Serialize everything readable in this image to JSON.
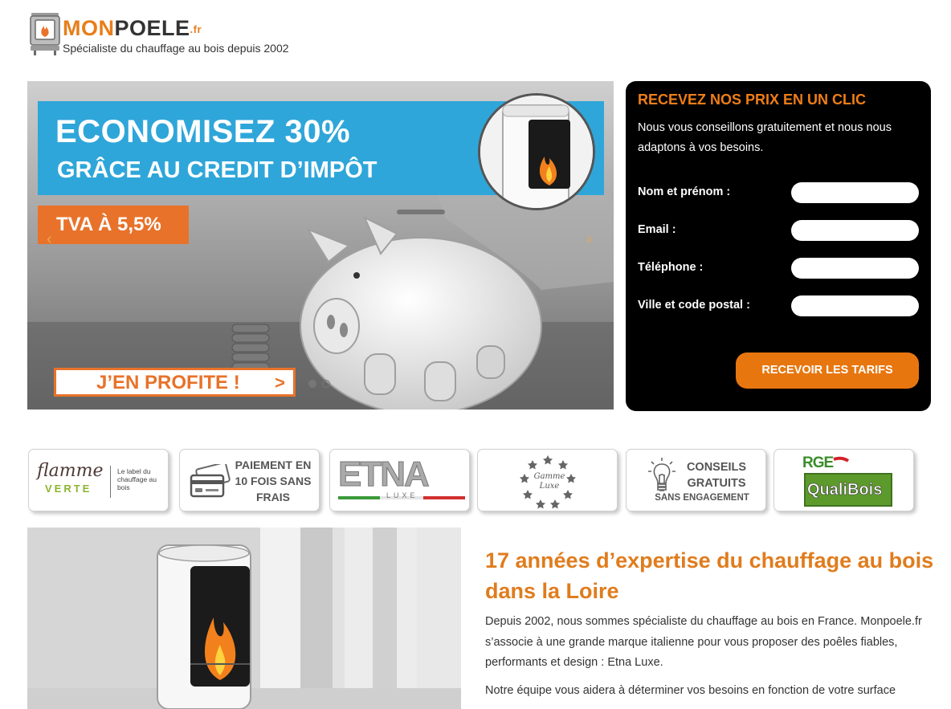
{
  "header": {
    "logo_mon": "MON",
    "logo_poele": "POELE",
    "logo_tld": ".fr",
    "tagline": "Spécialiste du chauffage au bois depuis 2002"
  },
  "hero": {
    "headline": "ECONOMISEZ 30%",
    "subheadline": "GRÂCE AU CREDIT D’IMPÔT",
    "tva": "TVA À 5,5%",
    "cta_label": "J’EN PROFITE !",
    "cta_arrow": ">",
    "prev_arrow": "‹",
    "next_arrow": "›",
    "slide_count": 2,
    "active_slide": 1
  },
  "form": {
    "title": "RECEVEZ NOS PRIX EN UN CLIC",
    "intro": "Nous vous conseillons gratuitement et nous nous adaptons à vos besoins.",
    "fields": [
      {
        "label": "Nom et prénom :",
        "value": "",
        "placeholder": ""
      },
      {
        "label": "Email :",
        "value": "",
        "placeholder": ""
      },
      {
        "label": "Téléphone :",
        "value": "",
        "placeholder": ""
      },
      {
        "label": "Ville et code postal :",
        "value": "",
        "placeholder": ""
      }
    ],
    "submit_label": "RECEVOIR LES TARIFS"
  },
  "badges": {
    "flamme_line1": "flamme",
    "flamme_line2": "VERTE",
    "flamme_desc": "Le label du chauffage au bois",
    "payment_text": "PAIEMENT EN 10 FOIS SANS FRAIS",
    "etna_text": "ETNA",
    "etna_sub": "LUXE",
    "gamme_text": "Gamme Luxe",
    "conseils_text": "CONSEILS GRATUITS",
    "conseils_sub": "SANS ENGAGEMENT",
    "rge_text": "RGE",
    "qualibois_text": "QualiBois"
  },
  "section": {
    "title": "17 années d’expertise du chauffage au bois dans la Loire",
    "paragraph1": "Depuis 2002, nous sommes spécialiste du chauffage au bois en France. Monpoele.fr s’associe à une grande marque italienne pour vous proposer des poêles fiables, performants et design : Etna Luxe.",
    "paragraph2": "Notre équipe vous aidera à déterminer vos besoins en fonction de votre surface"
  },
  "colors": {
    "brand_orange": "#e8722a",
    "accent_blue": "#2fa6d9",
    "form_background": "#000000",
    "title_orange": "#e07c1d"
  }
}
